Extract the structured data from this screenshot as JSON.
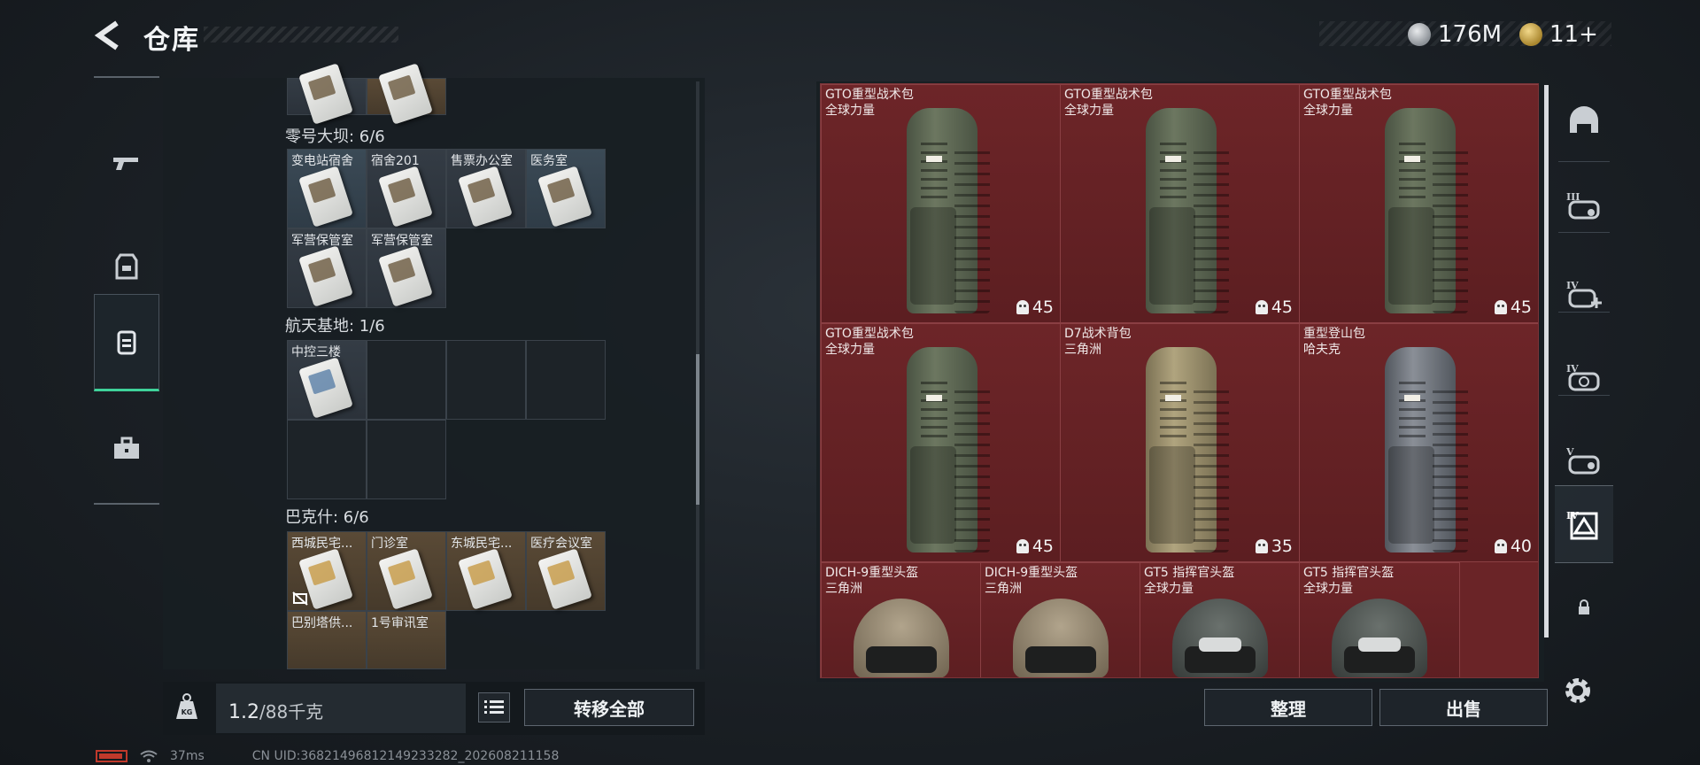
{
  "header": {
    "title": "仓库",
    "currencies": [
      {
        "icon": "silver-coin-icon",
        "value": "176M"
      },
      {
        "icon": "gold-coin-icon",
        "value": "11+"
      }
    ]
  },
  "left_rail": [
    "gun-icon",
    "armor-icon",
    "backpack-icon",
    "toolbox-icon"
  ],
  "storage": {
    "groups": [
      {
        "label": "零号大坝: 6/6",
        "slots": [
          {
            "name": "变电站宿舍",
            "style": "blue"
          },
          {
            "name": "宿舍201",
            "style": "plain"
          },
          {
            "name": "售票办公室",
            "style": "plain"
          },
          {
            "name": "医务室",
            "style": "blue"
          },
          {
            "name": "军营保管室",
            "style": "plain"
          },
          {
            "name": "军营保管室",
            "style": "plain"
          }
        ]
      },
      {
        "label": "航天基地: 1/6",
        "slots": [
          {
            "name": "中控三楼",
            "style": "plain"
          }
        ]
      },
      {
        "label": "巴克什: 6/6",
        "slots": [
          {
            "name": "西城民宅...",
            "style": "gold"
          },
          {
            "name": "门诊室",
            "style": "gold"
          },
          {
            "name": "东城民宅...",
            "style": "gold"
          },
          {
            "name": "医疗会议室",
            "style": "gold"
          },
          {
            "name": "巴别塔供...",
            "style": "gold"
          },
          {
            "name": "1号审讯室",
            "style": "gold"
          }
        ]
      }
    ],
    "weight_current": "1.2",
    "weight_max": "/88千克",
    "transfer_all": "转移全部"
  },
  "items": {
    "backpacks": [
      {
        "name": "GTO重型战术包",
        "source": "全球力量",
        "durability": "45",
        "color": "#5f6a55"
      },
      {
        "name": "GTO重型战术包",
        "source": "全球力量",
        "durability": "45",
        "color": "#5f6a55"
      },
      {
        "name": "GTO重型战术包",
        "source": "全球力量",
        "durability": "45",
        "color": "#5f6a55"
      },
      {
        "name": "GTO重型战术包",
        "source": "全球力量",
        "durability": "45",
        "color": "#5f6a55"
      },
      {
        "name": "D7战术背包",
        "source": "三角洲",
        "durability": "35",
        "color": "#9b8f6c"
      },
      {
        "name": "重型登山包",
        "source": "哈夫克",
        "durability": "40",
        "color": "#6e737b"
      }
    ],
    "helmets": [
      {
        "name": "DICH-9重型头盔",
        "source": "三角洲",
        "color": "#8d806b"
      },
      {
        "name": "DICH-9重型头盔",
        "source": "三角洲",
        "color": "#8d806b"
      },
      {
        "name": "GT5 指挥官头盔",
        "source": "全球力量",
        "color": "#4c524f"
      },
      {
        "name": "GT5 指挥官头盔",
        "source": "全球力量",
        "color": "#4c524f"
      }
    ],
    "sort_label": "整理",
    "sell_label": "出售"
  },
  "right_rail": [
    {
      "icon": "helmet-filter-icon",
      "tier": ""
    },
    {
      "icon": "tier3-helmet-icon",
      "tier": "III"
    },
    {
      "icon": "tier4-helmet-plus-icon",
      "tier": "IV"
    },
    {
      "icon": "tier4-helmet-icon",
      "tier": "IV"
    },
    {
      "icon": "tier5-helmet-icon",
      "tier": "V"
    },
    {
      "icon": "tier4-delta-helmet-icon",
      "tier": "IV"
    },
    {
      "icon": "lock-icon",
      "tier": ""
    }
  ],
  "status_bar": {
    "ping": "37ms",
    "uid": "CN UID:3682149681214923328​2_202608211158"
  }
}
